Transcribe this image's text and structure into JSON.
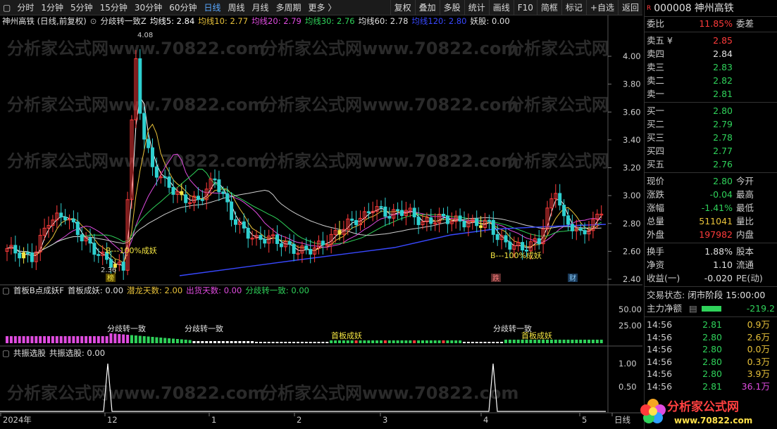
{
  "toolbar": {
    "periods": [
      "分时",
      "1分钟",
      "5分钟",
      "15分钟",
      "30分钟",
      "60分钟",
      "日线",
      "周线",
      "月线",
      "多周期",
      "更多 〉"
    ],
    "active_period": "日线",
    "right_buttons": [
      "复权",
      "叠加",
      "多股",
      "统计",
      "画线",
      "F10",
      "简框",
      "标记",
      "+自选",
      "返回"
    ]
  },
  "main_legend": {
    "stock": "神州高铁 (日线,前复权)",
    "indicator": "分歧转一致Z",
    "ma5": "均线5: 2.84",
    "ma10": "均线10: 2.77",
    "ma20": "均线20: 2.79",
    "ma30": "均线30: 2.76",
    "ma60": "均线60: 2.78",
    "ma120": "均线120: 2.80",
    "yao": "妖股: 0.00"
  },
  "colors": {
    "up": "#ff3b3b",
    "down": "#2fd0d0",
    "ma5": "#ffffff",
    "ma10": "#e8c23a",
    "ma20": "#e04ce0",
    "ma30": "#2fd25a",
    "ma60": "#cfcfcf",
    "ma120": "#3848ff",
    "yellow": "#f5e642",
    "green": "#2fd25a",
    "red": "#ff3b3b",
    "magenta": "#e04ce0"
  },
  "main_axis": [
    "4.00",
    "3.80",
    "3.60",
    "3.40",
    "3.20",
    "3.00",
    "2.80",
    "2.60",
    "2.40"
  ],
  "annotations": {
    "high": "4.08",
    "low": "2.36",
    "b1": "B---100%成妖",
    "b2": "B---100%成妖",
    "tag_bang": "榜",
    "tag_die": "跌",
    "tag_cai": "财"
  },
  "sub1_legend": {
    "name": "首板B点成妖F",
    "shouban": "首板成妖: 0.00",
    "qianlong": "潜龙天数: 2.00",
    "chuhuo": "出货天数: 0.00",
    "fenqi": "分歧转一致: 0.00"
  },
  "sub1_axis": [
    "50.00",
    "25.00"
  ],
  "sub1_labels": {
    "fq1": "分歧转一致",
    "fq2": "分歧转一致",
    "fq3": "分歧转一致",
    "sb1": "首板成妖",
    "sb2": "首板成妖"
  },
  "sub2_legend": {
    "name": "共振选股",
    "value": "共振选股: 0.00"
  },
  "sub2_axis": [
    "1.00",
    "0.50"
  ],
  "x_axis": [
    {
      "label": "2024年"
    },
    {
      "label": "12"
    },
    {
      "label": "1"
    },
    {
      "label": "2"
    },
    {
      "label": "3"
    },
    {
      "label": "4"
    },
    {
      "label": "5"
    },
    {
      "label": "日线"
    }
  ],
  "panel": {
    "badge": "R",
    "code": "000008",
    "name": "神州高铁",
    "webi_label": "委比",
    "webi": "11.85%",
    "wecha_label": "委差",
    "asks": [
      {
        "label": "卖五 ¥",
        "price": "2.85"
      },
      {
        "label": "卖四",
        "price": "2.84"
      },
      {
        "label": "卖三",
        "price": "2.83"
      },
      {
        "label": "卖二",
        "price": "2.82"
      },
      {
        "label": "卖一",
        "price": "2.81"
      }
    ],
    "bids": [
      {
        "label": "买一",
        "price": "2.80"
      },
      {
        "label": "买二",
        "price": "2.79"
      },
      {
        "label": "买三",
        "price": "2.78"
      },
      {
        "label": "买四",
        "price": "2.77"
      },
      {
        "label": "买五",
        "price": "2.76"
      }
    ],
    "stats1": [
      {
        "l1": "现价",
        "v1": "2.80",
        "l2": "今开"
      },
      {
        "l1": "涨跌",
        "v1": "-0.04",
        "l2": "最高"
      },
      {
        "l1": "涨幅",
        "v1": "-1.41%",
        "l2": "最低"
      },
      {
        "l1": "总量",
        "v1": "511041",
        "l2": "量比"
      },
      {
        "l1": "外盘",
        "v1": "197982",
        "l2": "内盘"
      }
    ],
    "stats2": [
      {
        "l1": "换手",
        "v1": "1.88%",
        "l2": "股本"
      },
      {
        "l1": "净资",
        "v1": "1.10",
        "l2": "流通"
      },
      {
        "l1": "收益(一)",
        "v1": "-0.020",
        "l2": "PE(动)"
      }
    ],
    "status_label": "交易状态:",
    "status": "闭市阶段 15:00:00",
    "main_net_label": "主力净额",
    "main_net": "-219.2",
    "ticks": [
      {
        "t": "14:56",
        "p": "2.81",
        "v": "0.9万"
      },
      {
        "t": "14:56",
        "p": "2.80",
        "v": "2.6万"
      },
      {
        "t": "14:56",
        "p": "2.80",
        "v": "0.0万"
      },
      {
        "t": "14:56",
        "p": "2.80",
        "v": "0.3万"
      },
      {
        "t": "14:56",
        "p": "2.80",
        "v": "3.9万"
      },
      {
        "t": "14:56",
        "p": "2.81",
        "v": "36.1万"
      }
    ],
    "watermark": "分析家公式网",
    "watermark_url": "www.70822.com"
  }
}
